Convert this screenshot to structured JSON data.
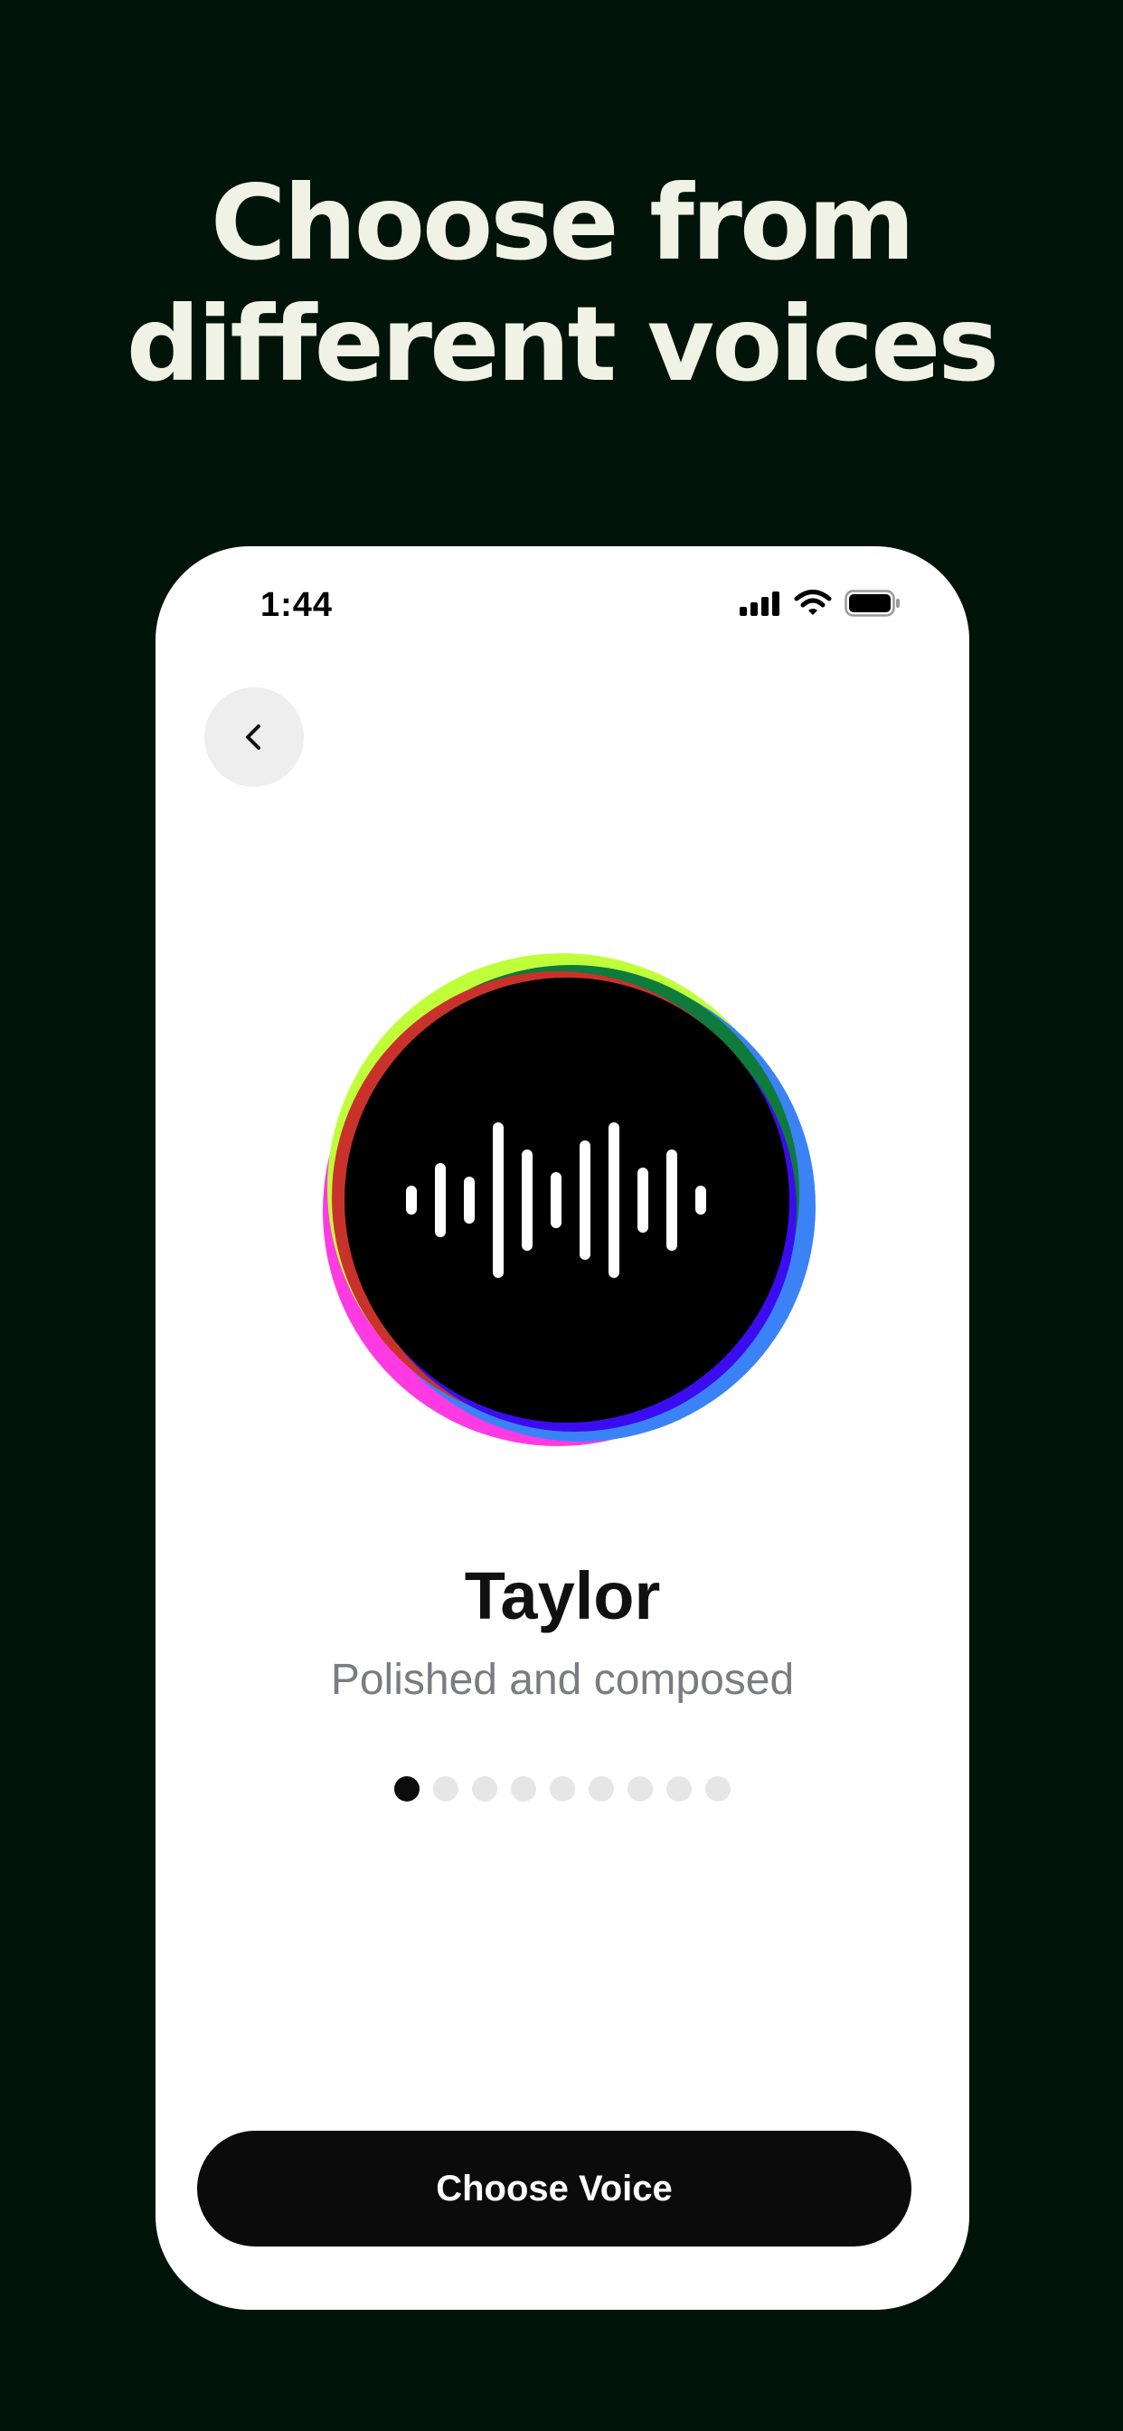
{
  "headline": {
    "line1": "Choose from",
    "line2": "different voices"
  },
  "status_bar": {
    "time": "1:44",
    "icons": [
      "cellular-signal-icon",
      "wifi-icon",
      "battery-icon"
    ]
  },
  "navigation": {
    "back_icon": "chevron-left-icon"
  },
  "voice": {
    "name": "Taylor",
    "description": "Polished and composed",
    "avatar_icon": "audio-waveform-icon",
    "ring_colors": [
      "#BFFF3A",
      "#0E7A3C",
      "#3B82F6",
      "#3B0CF0",
      "#FF2FE0",
      "#C9322A"
    ]
  },
  "pager": {
    "total": 9,
    "current": 1
  },
  "cta": {
    "label": "Choose Voice"
  },
  "colors": {
    "background": "#001409",
    "headline": "#F1F2E6",
    "card": "#FFFFFF",
    "button": "#0B0B0B"
  }
}
